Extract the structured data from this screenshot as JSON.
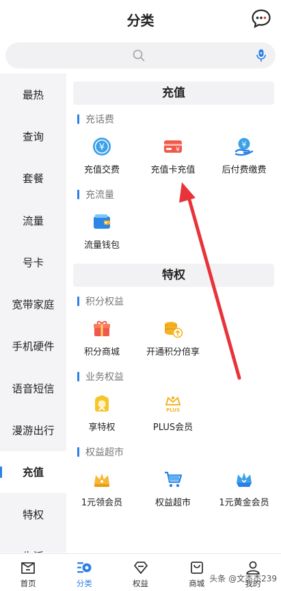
{
  "header": {
    "title": "分类"
  },
  "search": {
    "placeholder": ""
  },
  "sidebar": {
    "items": [
      {
        "label": "最热"
      },
      {
        "label": "查询"
      },
      {
        "label": "套餐"
      },
      {
        "label": "流量"
      },
      {
        "label": "号卡"
      },
      {
        "label": "宽带家庭"
      },
      {
        "label": "手机硬件"
      },
      {
        "label": "语音短信"
      },
      {
        "label": "漫游出行"
      },
      {
        "label": "充值"
      },
      {
        "label": "特权"
      },
      {
        "label": "生活"
      }
    ],
    "active": "充值"
  },
  "content": {
    "sections": [
      {
        "title": "充值",
        "groups": [
          {
            "title": "充话费",
            "items": [
              {
                "label": "充值交费",
                "icon": "yuan-coin-icon"
              },
              {
                "label": "充值卡充值",
                "icon": "recharge-card-icon"
              },
              {
                "label": "后付费缴费",
                "icon": "hand-coin-icon"
              }
            ]
          },
          {
            "title": "充流量",
            "items": [
              {
                "label": "流量钱包",
                "icon": "wallet-icon"
              }
            ]
          }
        ]
      },
      {
        "title": "特权",
        "groups": [
          {
            "title": "积分权益",
            "items": [
              {
                "label": "积分商城",
                "icon": "gift-icon"
              },
              {
                "label": "开通积分倍享",
                "icon": "coins-up-icon"
              }
            ]
          },
          {
            "title": "业务权益",
            "items": [
              {
                "label": "享特权",
                "icon": "vip-badge-icon"
              },
              {
                "label": "PLUS会员",
                "icon": "plus-crown-icon"
              }
            ]
          },
          {
            "title": "权益超市",
            "items": [
              {
                "label": "1元领会员",
                "icon": "crown-icon"
              },
              {
                "label": "权益超市",
                "icon": "cart-icon"
              },
              {
                "label": "1元黄金会员",
                "icon": "blue-crown-icon"
              }
            ]
          }
        ]
      }
    ]
  },
  "tabbar": {
    "tabs": [
      {
        "label": "首页",
        "icon": "home-icon"
      },
      {
        "label": "分类",
        "icon": "category-icon"
      },
      {
        "label": "权益",
        "icon": "diamond-icon"
      },
      {
        "label": "商城",
        "icon": "shop-bag-icon"
      },
      {
        "label": "我的",
        "icon": "user-icon"
      }
    ],
    "active": "分类"
  },
  "watermark": "头条 @文杰杰239",
  "colors": {
    "accent": "#2b7fe8",
    "arrow": "#e8333a"
  }
}
